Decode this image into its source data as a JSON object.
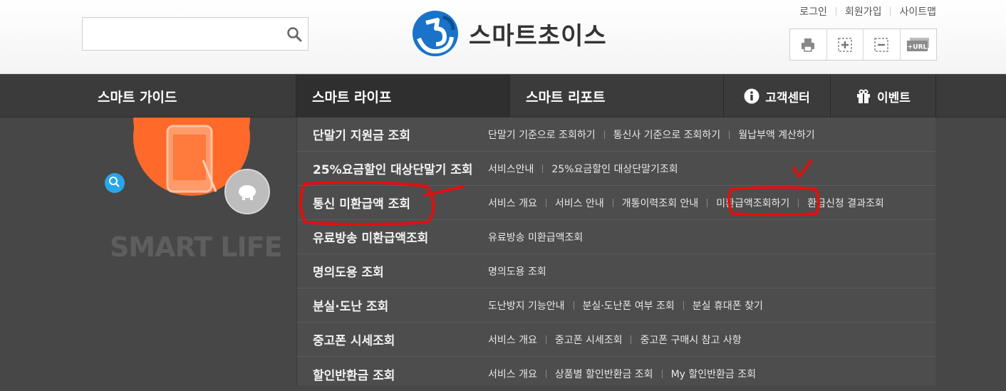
{
  "header": {
    "search": {
      "value": "",
      "placeholder": ""
    },
    "logo_text": "스마트초이스",
    "util_links": [
      "로그인",
      "회원가입",
      "사이트맵"
    ]
  },
  "nav": {
    "items": [
      "스마트 가이드",
      "스마트 라이프",
      "스마트 리포트"
    ],
    "support": "고객센터",
    "event": "이벤트"
  },
  "sidebar": {
    "label": "SMART LIFE"
  },
  "menu": [
    {
      "title": "단말기 지원금 조회",
      "links": [
        "단말기 기준으로 조회하기",
        "통신사 기준으로 조회하기",
        "월납부액 계산하기"
      ]
    },
    {
      "title": "25%요금할인 대상단말기 조회",
      "links": [
        "서비스안내",
        "25%요금할인 대상단말기조회"
      ]
    },
    {
      "title": "통신 미환급액 조회",
      "links": [
        "서비스 개요",
        "서비스 안내",
        "개통이력조회 안내",
        "미환급액조회하기",
        "환급신청 결과조회"
      ]
    },
    {
      "title": "유료방송 미환급액조회",
      "links": [
        "유료방송 미환급액조회"
      ]
    },
    {
      "title": "명의도용 조회",
      "links": [
        "명의도용 조회"
      ]
    },
    {
      "title": "분실·도난 조회",
      "links": [
        "도난방지 기능안내",
        "분실·도난폰 여부 조회",
        "분실 휴대폰 찾기"
      ]
    },
    {
      "title": "중고폰 시세조회",
      "links": [
        "서비스 개요",
        "중고폰 시세조회",
        "중고폰 구매시 참고 사항"
      ]
    },
    {
      "title": "할인반환금 조회",
      "links": [
        "서비스 개요",
        "상품별 할인반환금 조회",
        "My 할인반환금 조회"
      ]
    }
  ],
  "colors": {
    "accent_orange": "#ff6a2b",
    "annotation_red": "#e01010",
    "nav_bg": "#3b3b3b",
    "menu_bg": "#4d4d4d"
  }
}
